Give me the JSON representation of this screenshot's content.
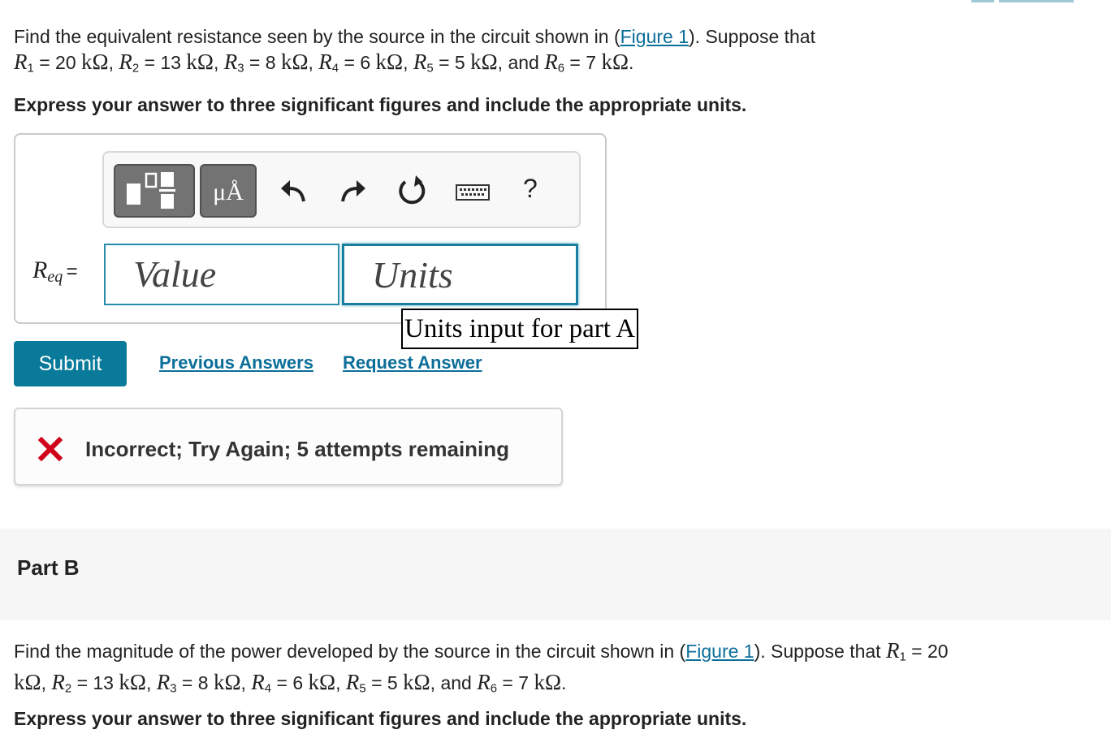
{
  "part_a": {
    "problem": {
      "line1_prefix": "Find the equivalent resistance seen by the source in the circuit shown in (",
      "figure_link": "Figure 1",
      "line1_suffix": "). Suppose that",
      "r1_sym": "R",
      "r1_sub": "1",
      "r1_val": "= 20",
      "r2_sym": "R",
      "r2_sub": "2",
      "r2_val": "= 13",
      "r3_sym": "R",
      "r3_sub": "3",
      "r3_val": "= 8",
      "r4_sym": "R",
      "r4_sub": "4",
      "r4_val": "= 6",
      "r5_sym": "R",
      "r5_sub": "5",
      "r5_val": "= 5",
      "r6_sym": "R",
      "r6_sub": "6",
      "r6_val": "= 7",
      "unit": "kΩ",
      "and": "and"
    },
    "instruction": "Express your answer to three significant figures and include the appropriate units.",
    "toolbar": {
      "units_button_label": "μÅ",
      "help_label": "?"
    },
    "answer": {
      "label_symbol": "R",
      "label_sub": "eq",
      "label_equals": "=",
      "value_placeholder": "Value",
      "units_placeholder": "Units",
      "units_tooltip": "Units input for part A"
    },
    "submit_label": "Submit",
    "previous_answers_label": "Previous Answers",
    "request_answer_label": "Request Answer",
    "feedback": "Incorrect; Try Again; 5 attempts remaining"
  },
  "part_b": {
    "title": "Part B",
    "problem": {
      "line1_prefix": "Find the magnitude of the power developed by the source in the circuit shown in (",
      "figure_link": "Figure 1",
      "line1_suffix": "). Suppose that",
      "r1_sym": "R",
      "r1_sub": "1",
      "r1_val": "= 20",
      "r2_sym": "R",
      "r2_sub": "2",
      "r2_val": "= 13",
      "r3_sym": "R",
      "r3_sub": "3",
      "r3_val": "= 8",
      "r4_sym": "R",
      "r4_sub": "4",
      "r4_val": "= 6",
      "r5_sym": "R",
      "r5_sub": "5",
      "r5_val": "= 5",
      "r6_sym": "R",
      "r6_sub": "6",
      "r6_val": "= 7",
      "unit": "kΩ",
      "and": "and"
    },
    "instruction": "Express your answer to three significant figures and include the appropriate units."
  },
  "colors": {
    "link": "#0b6e99",
    "submit_bg": "#0a7a9a",
    "incorrect_icon": "#d0021b",
    "units_field_border": "#1a7fa0"
  },
  "icons": [
    "templates-icon",
    "units-icon",
    "undo-icon",
    "redo-icon",
    "reset-icon",
    "keyboard-icon",
    "help-icon",
    "incorrect-icon"
  ]
}
